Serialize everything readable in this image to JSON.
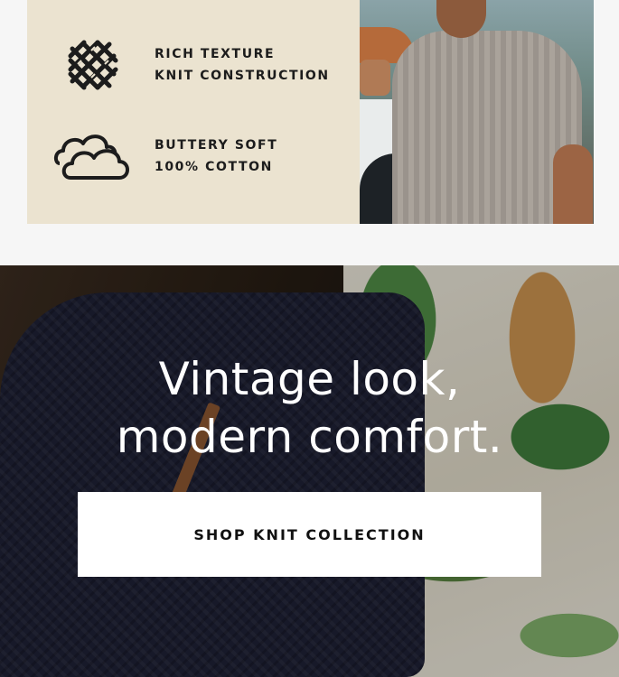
{
  "features": [
    {
      "icon": "knit-texture-icon",
      "line1": "RICH TEXTURE",
      "line2": "KNIT CONSTRUCTION"
    },
    {
      "icon": "cloud-icon",
      "line1": "BUTTERY SOFT",
      "line2": "100% COTTON"
    }
  ],
  "hero": {
    "headline_line1": "Vintage look,",
    "headline_line2": "modern comfort.",
    "cta_label": "SHOP KNIT COLLECTION"
  },
  "colors": {
    "card_bg": "#ebe3d0",
    "page_bg": "#f6f6f6",
    "text_dark": "#1c1c1c",
    "cta_bg": "#ffffff"
  }
}
